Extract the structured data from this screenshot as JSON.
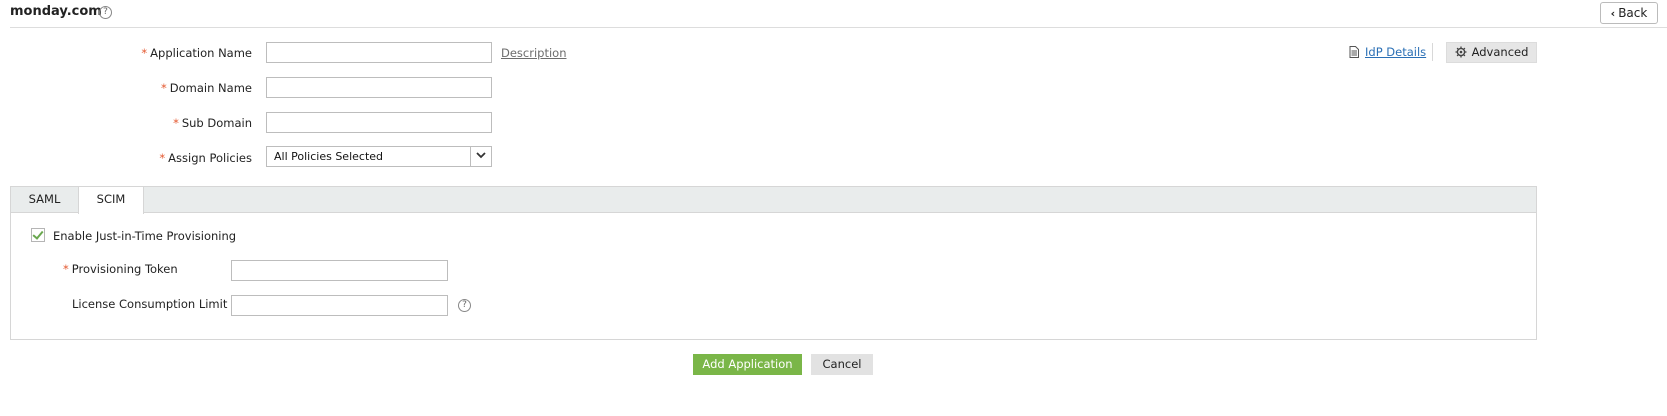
{
  "header": {
    "title": "monday.com",
    "help_icon": "question-circle-icon",
    "help_glyph": "?",
    "back_label": "Back",
    "back_icon": "chevron-left-icon"
  },
  "form": {
    "required_mark": "*",
    "application_name": {
      "label": "Application Name",
      "value": ""
    },
    "description_link": "Description",
    "domain_name": {
      "label": "Domain Name",
      "value": ""
    },
    "sub_domain": {
      "label": "Sub Domain",
      "value": ""
    },
    "assign_policies": {
      "label": "Assign Policies",
      "selected": "All Policies Selected"
    }
  },
  "top_right": {
    "idp_details_label": "IdP Details",
    "idp_icon": "document-icon",
    "advanced_label": "Advanced",
    "advanced_icon": "gear-icon"
  },
  "tabs": [
    {
      "label": "SAML",
      "active": false
    },
    {
      "label": "SCIM",
      "active": true
    }
  ],
  "scim": {
    "jit_label": "Enable Just-in-Time Provisioning",
    "jit_checked": true,
    "provisioning_token": {
      "label": "Provisioning Token",
      "value": ""
    },
    "license_limit": {
      "label": "License Consumption Limit",
      "value": ""
    },
    "help_glyph": "?"
  },
  "actions": {
    "add_label": "Add Application",
    "cancel_label": "Cancel"
  },
  "colors": {
    "required": "#e4572e",
    "primary_button": "#7ab648",
    "link": "#2a6fb5",
    "checkmark": "#6aa84f"
  }
}
